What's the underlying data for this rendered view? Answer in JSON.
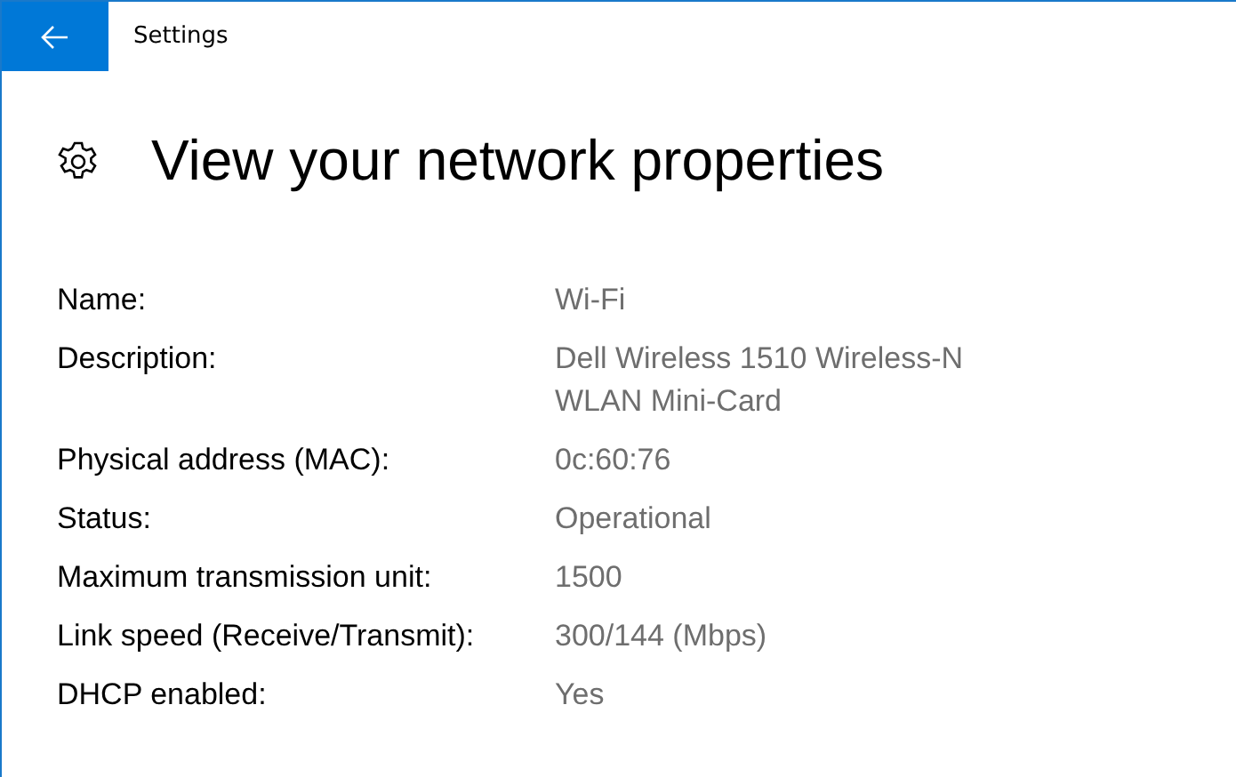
{
  "window": {
    "title": "Settings"
  },
  "page": {
    "heading": "View your network properties"
  },
  "properties": [
    {
      "label": "Name:",
      "value": "Wi-Fi"
    },
    {
      "label": "Description:",
      "value": "Dell Wireless 1510 Wireless-N WLAN Mini-Card"
    },
    {
      "label": "Physical address (MAC):",
      "value": "0c:60:76"
    },
    {
      "label": "Status:",
      "value": "Operational"
    },
    {
      "label": "Maximum transmission unit:",
      "value": "1500"
    },
    {
      "label": "Link speed (Receive/Transmit):",
      "value": "300/144 (Mbps)"
    },
    {
      "label": "DHCP enabled:",
      "value": "Yes"
    }
  ]
}
